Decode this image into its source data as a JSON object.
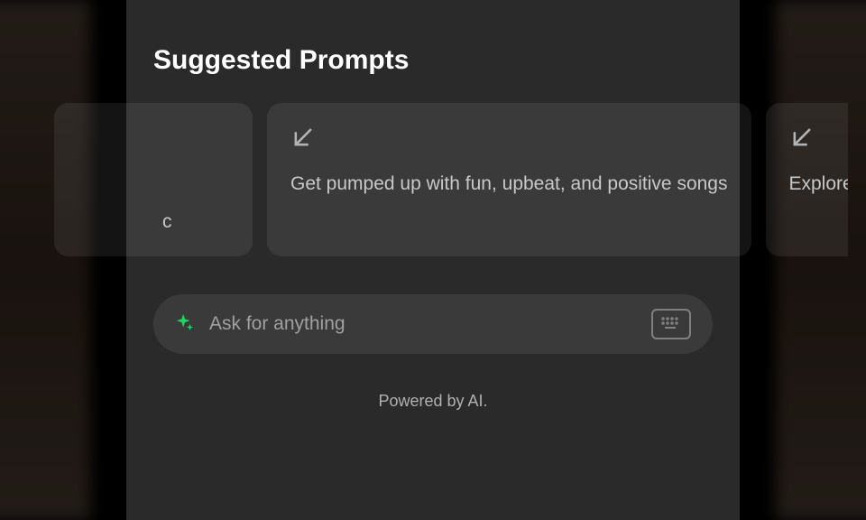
{
  "heading": "Suggested Prompts",
  "cards": [
    {
      "text": "c"
    },
    {
      "text": "Get pumped up with fun, upbeat, and positive songs"
    },
    {
      "text": "Explore a ni Witch Hous"
    }
  ],
  "input": {
    "placeholder": "Ask for anything"
  },
  "footer": "Powered by AI.",
  "colors": {
    "accent": "#1ed760"
  }
}
